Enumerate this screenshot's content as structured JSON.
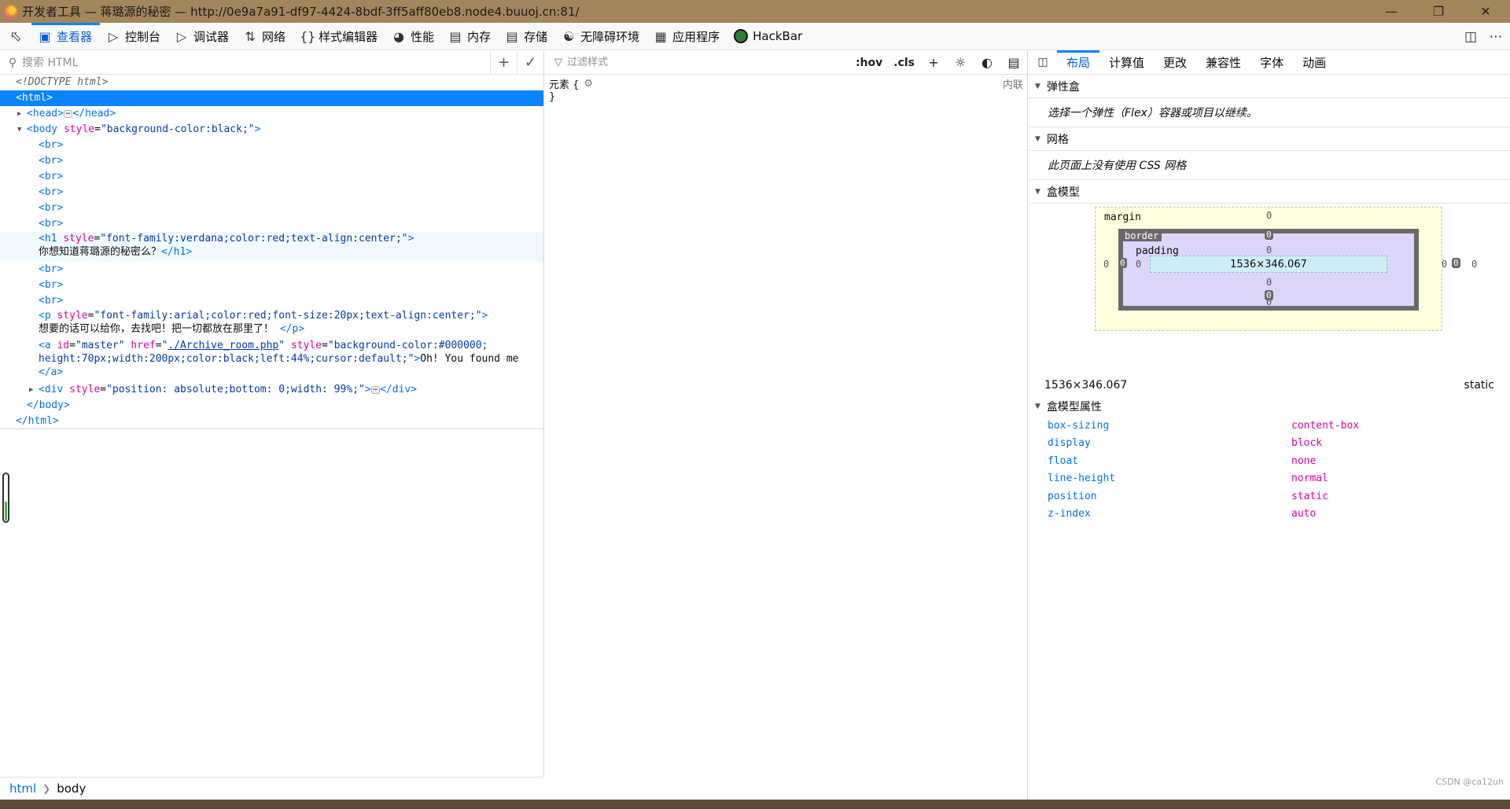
{
  "window": {
    "title": "开发者工具 — 蒋璐源的秘密 — http://0e9a7a91-df97-4424-8bdf-3ff5aff80eb8.node4.buuoj.cn:81/",
    "title_bar_color": "#a4865c"
  },
  "toolbar": {
    "tabs": [
      {
        "label": "查看器",
        "icon": "inspector-icon"
      },
      {
        "label": "控制台",
        "icon": "console-icon"
      },
      {
        "label": "调试器",
        "icon": "debugger-icon"
      },
      {
        "label": "网络",
        "icon": "network-icon"
      },
      {
        "label": "样式编辑器",
        "icon": "style-editor-icon"
      },
      {
        "label": "性能",
        "icon": "performance-icon"
      },
      {
        "label": "内存",
        "icon": "memory-icon"
      },
      {
        "label": "存储",
        "icon": "storage-icon"
      },
      {
        "label": "无障碍环境",
        "icon": "accessibility-icon"
      },
      {
        "label": "应用程序",
        "icon": "application-icon"
      },
      {
        "label": "HackBar",
        "icon": "hackbar-icon"
      }
    ],
    "selected_tab": "查看器",
    "accent_color": "#0a84ff"
  },
  "inspector": {
    "search_placeholder": "搜索 HTML",
    "markup": {
      "doctype": "<!DOCTYPE html>",
      "html_open": "<html>",
      "head_open": "<head>",
      "head_close": "</head>",
      "body_open_tag": "<body",
      "body_attr": "style",
      "body_attr_val": "\"background-color:black;\"",
      "body_open_end": ">",
      "br": "<br>",
      "h1_open_tag": "<h1",
      "h1_attr": "style",
      "h1_attr_val": "\"font-family:verdana;color:red;text-align:center;\"",
      "h1_open_end": ">",
      "h1_text": "你想知道蒋璐源的秘密么？",
      "h1_close": "</h1>",
      "p_open_tag": "<p",
      "p_attr": "style",
      "p_attr_val": "\"font-family:arial;color:red;font-size:20px;text-align:center;\"",
      "p_open_end": ">",
      "p_text": "想要的话可以给你，去找吧！把一切都放在那里了！",
      "p_close": "</p>",
      "a_open_tag": "<a",
      "a_id_attr": "id",
      "a_id_val": "\"master\"",
      "a_href_attr": "href",
      "a_href_q1": "\"",
      "a_href_val": "./Archive_room.php",
      "a_href_q2": "\"",
      "a_style_attr": "style",
      "a_style_val_1": "\"background-color:#000000;",
      "a_style_val_2": "height:70px;width:200px;color:black;left:44%;cursor:default;\"",
      "a_open_end": ">",
      "a_text": "Oh! You found me",
      "a_close": "</a>",
      "div_open_tag": "<div",
      "div_attr": "style",
      "div_attr_val": "\"position: absolute;bottom: 0;width: 99%;\"",
      "div_open_end": ">",
      "div_close": "</div>",
      "body_close": "</body>",
      "html_close": "</html>"
    },
    "breadcrumb": [
      "html",
      "body"
    ]
  },
  "rules": {
    "filter_placeholder": "过滤样式",
    "hov_label": ":hov",
    "cls_label": ".cls",
    "element_selector": "元素 {",
    "element_close": "}",
    "inline_label": "内联"
  },
  "layout": {
    "tabs": [
      "布局",
      "计算值",
      "更改",
      "兼容性",
      "字体",
      "动画"
    ],
    "selected_tab": "布局",
    "flexbox": {
      "title": "弹性盒",
      "message": "选择一个弹性（Flex）容器或项目以继续。"
    },
    "grid": {
      "title": "网格",
      "message": "此页面上没有使用 CSS 网格"
    },
    "box_model": {
      "title": "盒模型",
      "margin_label": "margin",
      "border_label": "border",
      "padding_label": "padding",
      "margin": {
        "top": "0",
        "right": "0",
        "bottom": "0",
        "left": "0"
      },
      "border": {
        "top": "0",
        "right": "0",
        "bottom": "0",
        "left": "0"
      },
      "padding": {
        "top": "0",
        "right": "0",
        "bottom": "0",
        "left": "0"
      },
      "content_size": "1536×346.067",
      "dimensions": "1536×346.067",
      "position": "static"
    },
    "box_props": {
      "title": "盒模型属性",
      "items": [
        {
          "name": "box-sizing",
          "value": "content-box"
        },
        {
          "name": "display",
          "value": "block"
        },
        {
          "name": "float",
          "value": "none"
        },
        {
          "name": "line-height",
          "value": "normal"
        },
        {
          "name": "position",
          "value": "static"
        },
        {
          "name": "z-index",
          "value": "auto"
        }
      ]
    }
  },
  "watermark": "CSDN @ca12uh"
}
